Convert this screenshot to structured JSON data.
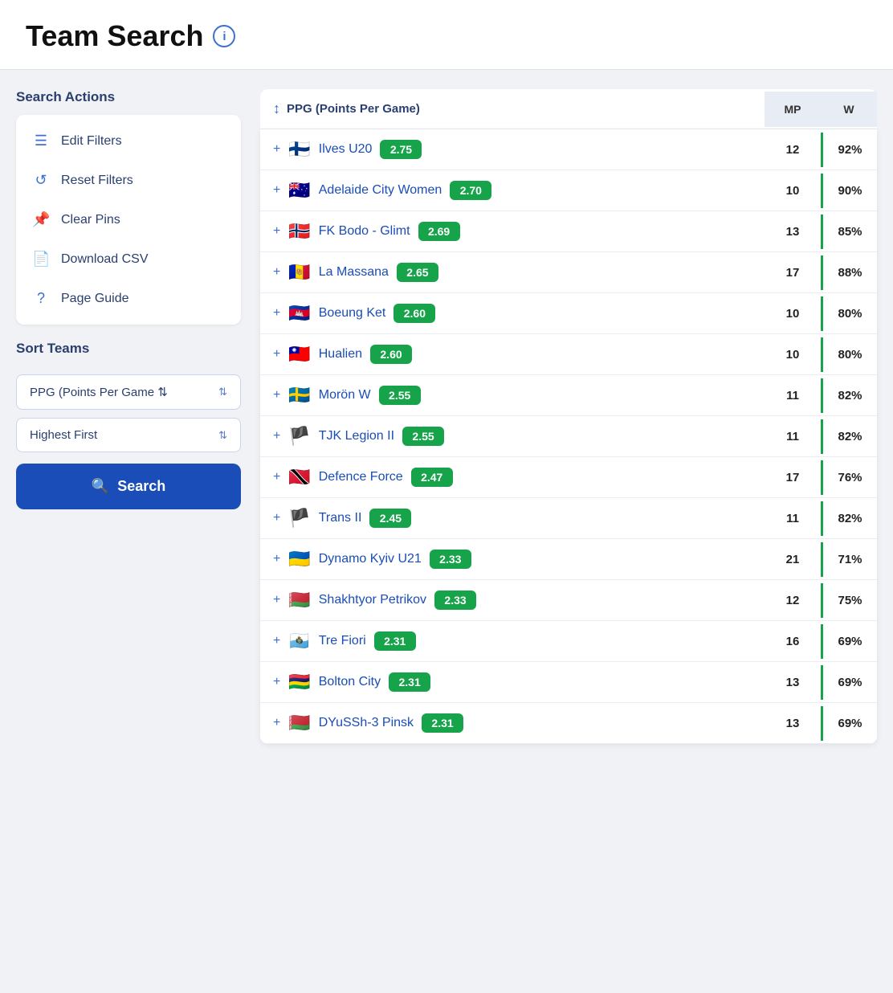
{
  "header": {
    "title": "Team Search",
    "info_icon_label": "i"
  },
  "sidebar": {
    "search_actions_label": "Search Actions",
    "actions": [
      {
        "id": "edit-filters",
        "icon": "☰",
        "label": "Edit Filters"
      },
      {
        "id": "reset-filters",
        "icon": "↺",
        "label": "Reset Filters"
      },
      {
        "id": "clear-pins",
        "icon": "📌",
        "label": "Clear Pins"
      },
      {
        "id": "download-csv",
        "icon": "📄",
        "label": "Download CSV"
      },
      {
        "id": "page-guide",
        "icon": "?",
        "label": "Page Guide"
      }
    ],
    "sort_label": "Sort Teams",
    "sort_field": "PPG (Points Per Game ⇅",
    "sort_order": "Highest First",
    "search_button": "Search"
  },
  "table": {
    "col_sort_label": "PPG (Points Per Game)",
    "col_mp": "MP",
    "col_w": "W",
    "rows": [
      {
        "flag": "🇫🇮",
        "name": "Ilves U20",
        "ppg": "2.75",
        "mp": 12,
        "w": "92%"
      },
      {
        "flag": "🇦🇺",
        "name": "Adelaide City Women",
        "ppg": "2.70",
        "mp": 10,
        "w": "90%"
      },
      {
        "flag": "🇳🇴",
        "name": "FK Bodo - Glimt",
        "ppg": "2.69",
        "mp": 13,
        "w": "85%"
      },
      {
        "flag": "🇦🇩",
        "name": "La Massana",
        "ppg": "2.65",
        "mp": 17,
        "w": "88%"
      },
      {
        "flag": "🇰🇭",
        "name": "Boeung Ket",
        "ppg": "2.60",
        "mp": 10,
        "w": "80%"
      },
      {
        "flag": "🇹🇼",
        "name": "Hualien",
        "ppg": "2.60",
        "mp": 10,
        "w": "80%"
      },
      {
        "flag": "🇸🇪",
        "name": "Morön W",
        "ppg": "2.55",
        "mp": 11,
        "w": "82%"
      },
      {
        "flag": "🏴",
        "name": "TJK Legion II",
        "ppg": "2.55",
        "mp": 11,
        "w": "82%"
      },
      {
        "flag": "🇹🇹",
        "name": "Defence Force",
        "ppg": "2.47",
        "mp": 17,
        "w": "76%"
      },
      {
        "flag": "🏴",
        "name": "Trans II",
        "ppg": "2.45",
        "mp": 11,
        "w": "82%"
      },
      {
        "flag": "🇺🇦",
        "name": "Dynamo Kyiv U21",
        "ppg": "2.33",
        "mp": 21,
        "w": "71%"
      },
      {
        "flag": "🇧🇾",
        "name": "Shakhtyor Petrikov",
        "ppg": "2.33",
        "mp": 12,
        "w": "75%"
      },
      {
        "flag": "🇸🇲",
        "name": "Tre Fiori",
        "ppg": "2.31",
        "mp": 16,
        "w": "69%"
      },
      {
        "flag": "🇲🇺",
        "name": "Bolton City",
        "ppg": "2.31",
        "mp": 13,
        "w": "69%"
      },
      {
        "flag": "🇧🇾",
        "name": "DYuSSh-3 Pinsk",
        "ppg": "2.31",
        "mp": 13,
        "w": "69%"
      }
    ]
  }
}
